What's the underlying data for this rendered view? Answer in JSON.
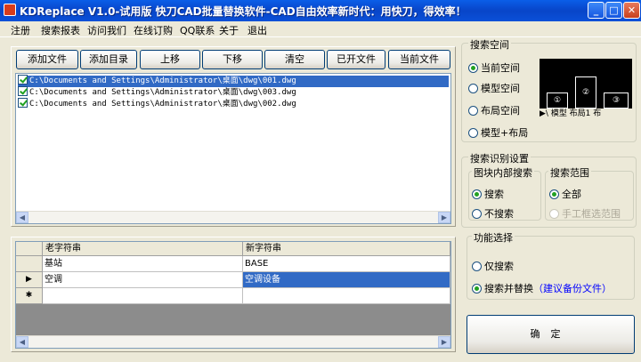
{
  "window": {
    "title": "KDReplace V1.0-试用版 快刀CAD批量替换软件-CAD自由效率新时代：用快刀，得效率！",
    "minimize_label": "_",
    "maximize_label": "□",
    "close_label": "✕"
  },
  "menu": [
    "注册",
    "搜索报表",
    "访问我们",
    "在线订购",
    "QQ联系",
    "关于",
    "退出"
  ],
  "toolbar": {
    "add_file": "添加文件",
    "add_dir": "添加目录",
    "move_up": "上移",
    "move_down": "下移",
    "clear": "清空",
    "opened_files": "已开文件",
    "current_file": "当前文件"
  },
  "files": [
    {
      "path": "C:\\Documents and Settings\\Administrator\\桌面\\dwg\\001.dwg",
      "checked": true,
      "selected": true
    },
    {
      "path": "C:\\Documents and Settings\\Administrator\\桌面\\dwg\\003.dwg",
      "checked": true,
      "selected": false
    },
    {
      "path": "C:\\Documents and Settings\\Administrator\\桌面\\dwg\\002.dwg",
      "checked": true,
      "selected": false
    }
  ],
  "grid": {
    "col_old": "老字符串",
    "col_new": "新字符串",
    "rows": [
      {
        "marker": "",
        "old": "基站",
        "new": "BASE",
        "selected": false
      },
      {
        "marker": "▶",
        "old": "空调",
        "new": "空调设备",
        "selected": true
      },
      {
        "marker": "✱",
        "old": "",
        "new": "",
        "selected": false
      }
    ]
  },
  "search_space": {
    "label": "搜索空间",
    "options": [
      "当前空间",
      "模型空间",
      "布局空间",
      "模型+布局"
    ],
    "selected": 0,
    "preview_tabs": "▶\\  模型  布局1  布"
  },
  "recognition": {
    "label": "搜索识别设置",
    "block_group": "图块内部搜索",
    "block_options": [
      "搜索",
      "不搜索"
    ],
    "block_selected": 0,
    "range_group": "搜索范围",
    "range_options": [
      "全部",
      "手工框选范围"
    ],
    "range_selected": 0
  },
  "function": {
    "label": "功能选择",
    "options": [
      "仅搜索",
      "搜索并替换"
    ],
    "selected": 1,
    "hint": "（建议备份文件）"
  },
  "ok_button": "确定"
}
